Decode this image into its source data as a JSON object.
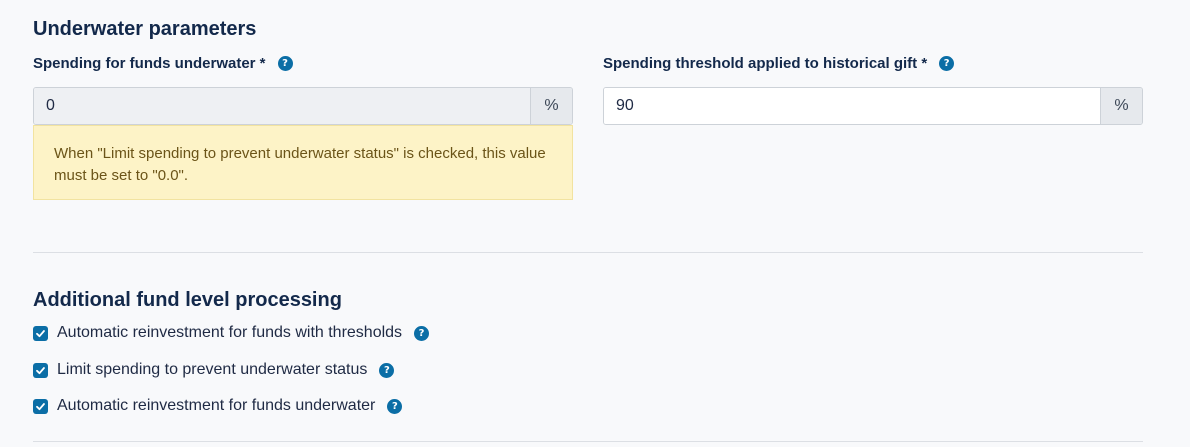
{
  "underwater": {
    "title": "Underwater parameters",
    "spending_label": "Spending for funds underwater *",
    "spending_value": "0",
    "spending_unit": "%",
    "threshold_label": "Spending threshold applied to historical gift *",
    "threshold_value": "90",
    "threshold_unit": "%",
    "warning": "When \"Limit spending to prevent underwater status\" is checked, this value must be set to \"0.0\"."
  },
  "processing": {
    "title": "Additional fund level processing",
    "options": [
      {
        "label": "Automatic reinvestment for funds with thresholds",
        "checked": true
      },
      {
        "label": "Limit spending to prevent underwater status",
        "checked": true
      },
      {
        "label": "Automatic reinvestment for funds underwater",
        "checked": true
      }
    ]
  },
  "help_glyph": "?",
  "colors": {
    "accent": "#0b6ea6",
    "heading": "#13294b",
    "warning_bg": "#fdf3c7"
  }
}
